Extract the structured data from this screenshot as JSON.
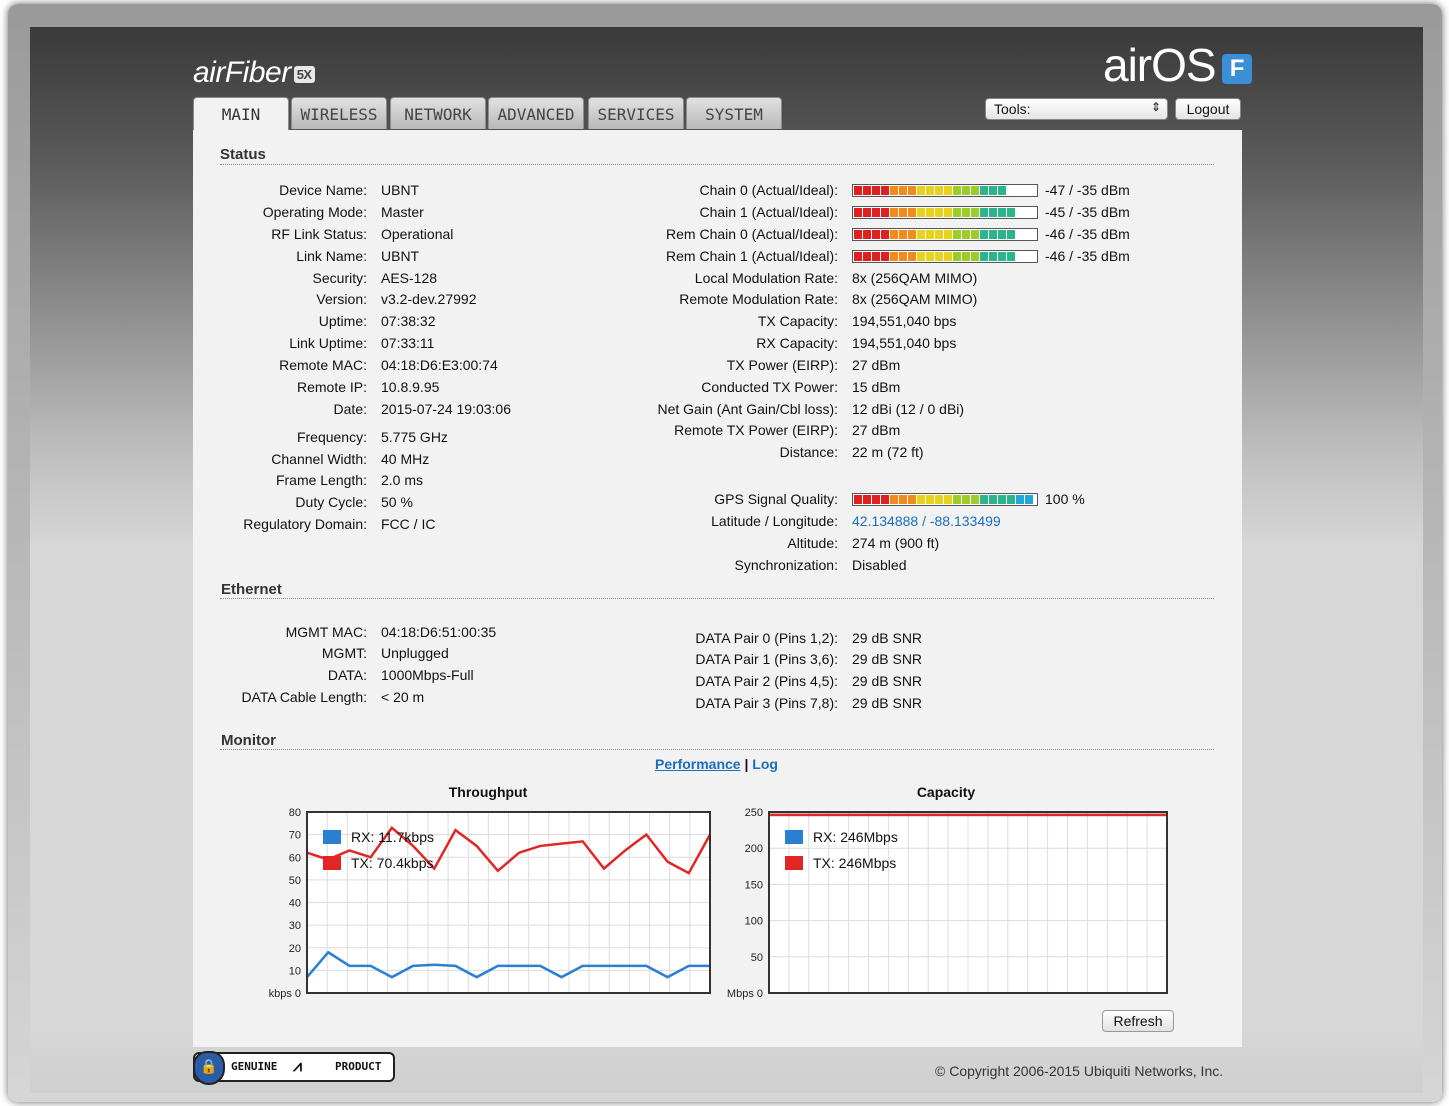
{
  "header": {
    "brand_left": "air",
    "brand_left_rest": "Fiber",
    "brand_left_badge": "5X",
    "brand_right": "airOS",
    "brand_right_badge": "F",
    "tools_label": "Tools:",
    "logout_label": "Logout"
  },
  "tabs": [
    {
      "label": "MAIN",
      "active": true
    },
    {
      "label": "WIRELESS"
    },
    {
      "label": "NETWORK"
    },
    {
      "label": "ADVANCED"
    },
    {
      "label": "SERVICES"
    },
    {
      "label": "SYSTEM"
    }
  ],
  "status": {
    "title": "Status",
    "left": [
      {
        "label": "Device Name:",
        "value": "UBNT"
      },
      {
        "label": "Operating Mode:",
        "value": "Master"
      },
      {
        "label": "RF Link Status:",
        "value": "Operational"
      },
      {
        "label": "Link Name:",
        "value": "UBNT"
      },
      {
        "label": "Security:",
        "value": "AES-128"
      },
      {
        "label": "Version:",
        "value": "v3.2-dev.27992"
      },
      {
        "label": "Uptime:",
        "value": "07:38:32"
      },
      {
        "label": "Link Uptime:",
        "value": "07:33:11"
      },
      {
        "label": "Remote MAC:",
        "value": "04:18:D6:E3:00:74"
      },
      {
        "label": "Remote IP:",
        "value": "10.8.9.95"
      },
      {
        "label": "Date:",
        "value": "2015-07-24 19:03:06"
      },
      {
        "label": "Frequency:",
        "value": "5.775 GHz"
      },
      {
        "label": "Channel Width:",
        "value": "40 MHz"
      },
      {
        "label": "Frame Length:",
        "value": "2.0 ms"
      },
      {
        "label": "Duty Cycle:",
        "value": "50 %"
      },
      {
        "label": "Regulatory Domain:",
        "value": "FCC / IC"
      }
    ],
    "signal_bars": [
      {
        "label": "Chain 0 (Actual/Ideal):",
        "value": "-47 / -35 dBm",
        "level": 0.87
      },
      {
        "label": "Chain 1 (Actual/Ideal):",
        "value": "-45 / -35 dBm",
        "level": 0.91
      },
      {
        "label": "Rem Chain 0 (Actual/Ideal):",
        "value": "-46 / -35 dBm",
        "level": 0.91
      },
      {
        "label": "Rem Chain 1 (Actual/Ideal):",
        "value": "-46 / -35 dBm",
        "level": 0.91
      }
    ],
    "right": [
      {
        "label": "Local Modulation Rate:",
        "value": "8x (256QAM MIMO)"
      },
      {
        "label": "Remote Modulation Rate:",
        "value": "8x (256QAM MIMO)"
      },
      {
        "label": "TX Capacity:",
        "value": "194,551,040 bps"
      },
      {
        "label": "RX Capacity:",
        "value": "194,551,040 bps"
      },
      {
        "label": "TX Power (EIRP):",
        "value": "27 dBm"
      },
      {
        "label": "Conducted TX Power:",
        "value": "15 dBm"
      },
      {
        "label": "Net Gain (Ant Gain/Cbl loss):",
        "value": "12 dBi (12 / 0 dBi)"
      },
      {
        "label": "Remote TX Power (EIRP):",
        "value": "27 dBm"
      },
      {
        "label": "Distance:",
        "value": "22 m (72 ft)"
      }
    ],
    "gps": {
      "label": "GPS Signal Quality:",
      "value": "100 %",
      "level": 1.0
    },
    "gps_rows": [
      {
        "label": "Latitude / Longitude:",
        "value": "42.134888 / -88.133499",
        "link": true
      },
      {
        "label": "Altitude:",
        "value": "274 m (900 ft)"
      },
      {
        "label": "Synchronization:",
        "value": "Disabled"
      }
    ]
  },
  "ethernet": {
    "title": "Ethernet",
    "left": [
      {
        "label": "MGMT MAC:",
        "value": "04:18:D6:51:00:35"
      },
      {
        "label": "MGMT:",
        "value": "Unplugged"
      },
      {
        "label": "DATA:",
        "value": "1000Mbps-Full"
      },
      {
        "label": "DATA Cable Length:",
        "value": "< 20 m"
      }
    ],
    "right": [
      {
        "label": "DATA Pair 0 (Pins 1,2):",
        "value": "29 dB SNR"
      },
      {
        "label": "DATA Pair 1 (Pins 3,6):",
        "value": "29 dB SNR"
      },
      {
        "label": "DATA Pair 2 (Pins 4,5):",
        "value": "29 dB SNR"
      },
      {
        "label": "DATA Pair 3 (Pins 7,8):",
        "value": "29 dB SNR"
      }
    ]
  },
  "monitor": {
    "title": "Monitor",
    "link_performance": "Performance",
    "separator": "|",
    "link_log": "Log",
    "refresh_label": "Refresh"
  },
  "chart_data": [
    {
      "type": "line",
      "title": "Throughput",
      "unit": "kbps",
      "ylim": [
        0,
        80
      ],
      "yticks": [
        0,
        10,
        20,
        30,
        40,
        50,
        60,
        70,
        80
      ],
      "grid": true,
      "legend_position": "top-left",
      "series": [
        {
          "name": "RX: 11.7kbps",
          "color": "#2a7fd0",
          "values": [
            7,
            18,
            12,
            12,
            7,
            12,
            12.5,
            12,
            7,
            12,
            12,
            12,
            7,
            12,
            12,
            12,
            12,
            7,
            12,
            12
          ]
        },
        {
          "name": "TX: 70.4kbps",
          "color": "#e22626",
          "values": [
            62,
            59,
            63,
            60,
            73,
            65,
            55,
            72,
            65,
            54,
            62,
            65,
            66,
            67,
            55,
            63,
            70,
            58,
            53,
            70
          ]
        }
      ]
    },
    {
      "type": "line",
      "title": "Capacity",
      "unit": "Mbps",
      "ylim": [
        0,
        250
      ],
      "yticks": [
        0,
        50,
        100,
        150,
        200,
        250
      ],
      "grid": true,
      "legend_position": "top-left",
      "series": [
        {
          "name": "RX: 246Mbps",
          "color": "#2a7fd0",
          "values": [
            246,
            246
          ]
        },
        {
          "name": "TX: 246Mbps",
          "color": "#e22626",
          "values": [
            246,
            246
          ]
        }
      ]
    }
  ],
  "footer": {
    "genuine_left": "GENUINE",
    "genuine_right": "PRODUCT",
    "copyright": "© Copyright 2006-2015 Ubiquiti Networks, Inc."
  },
  "colors": {
    "accent_link": "#1a6fbf",
    "rx_series": "#2a7fd0",
    "tx_series": "#e22626"
  }
}
